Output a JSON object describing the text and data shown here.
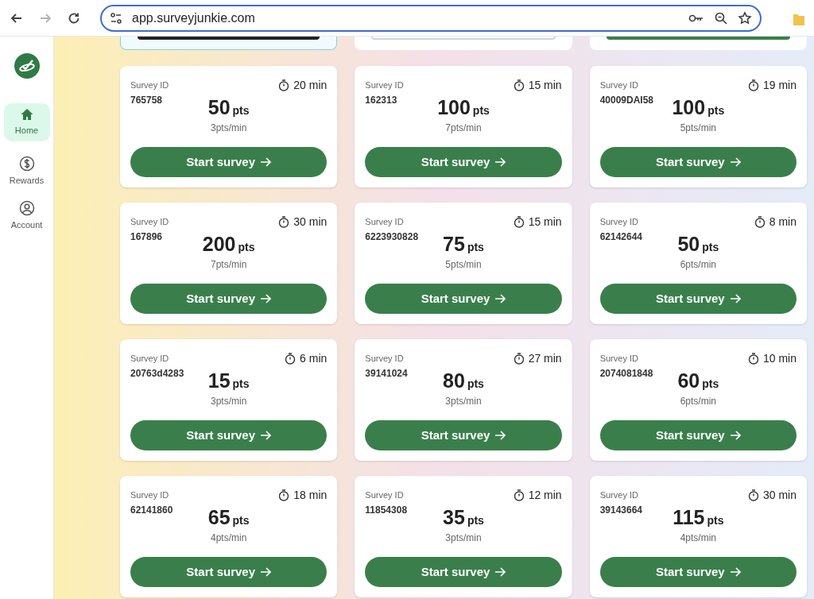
{
  "browser": {
    "url": "app.surveyjunkie.com",
    "forward_disabled": true
  },
  "sidebar": {
    "items": [
      {
        "label": "Home",
        "kind": "home",
        "selected": true
      },
      {
        "label": "Rewards",
        "kind": "rewards",
        "selected": false
      },
      {
        "label": "Account",
        "kind": "account",
        "selected": false
      }
    ]
  },
  "partial_cards": [
    {
      "kind": "featured"
    },
    {
      "kind": "outline"
    },
    {
      "kind": "filled"
    }
  ],
  "surveys": [
    {
      "id_label": "Survey ID",
      "id": "765758",
      "duration": "20 min",
      "points": "50",
      "unit": "pts",
      "rate": "3pts/min",
      "button": "Start survey"
    },
    {
      "id_label": "Survey ID",
      "id": "162313",
      "duration": "15 min",
      "points": "100",
      "unit": "pts",
      "rate": "7pts/min",
      "button": "Start survey"
    },
    {
      "id_label": "Survey ID",
      "id": "40009DAI58",
      "duration": "19 min",
      "points": "100",
      "unit": "pts",
      "rate": "5pts/min",
      "button": "Start survey"
    },
    {
      "id_label": "Survey ID",
      "id": "167896",
      "duration": "30 min",
      "points": "200",
      "unit": "pts",
      "rate": "7pts/min",
      "button": "Start survey"
    },
    {
      "id_label": "Survey ID",
      "id": "6223930828",
      "duration": "15 min",
      "points": "75",
      "unit": "pts",
      "rate": "5pts/min",
      "button": "Start survey"
    },
    {
      "id_label": "Survey ID",
      "id": "62142644",
      "duration": "8 min",
      "points": "50",
      "unit": "pts",
      "rate": "6pts/min",
      "button": "Start survey"
    },
    {
      "id_label": "Survey ID",
      "id": "20763d4283",
      "duration": "6 min",
      "points": "15",
      "unit": "pts",
      "rate": "3pts/min",
      "button": "Start survey"
    },
    {
      "id_label": "Survey ID",
      "id": "39141024",
      "duration": "27 min",
      "points": "80",
      "unit": "pts",
      "rate": "3pts/min",
      "button": "Start survey"
    },
    {
      "id_label": "Survey ID",
      "id": "2074081848",
      "duration": "10 min",
      "points": "60",
      "unit": "pts",
      "rate": "6pts/min",
      "button": "Start survey"
    },
    {
      "id_label": "Survey ID",
      "id": "62141860",
      "duration": "18 min",
      "points": "65",
      "unit": "pts",
      "rate": "4pts/min",
      "button": "Start survey"
    },
    {
      "id_label": "Survey ID",
      "id": "11854308",
      "duration": "12 min",
      "points": "35",
      "unit": "pts",
      "rate": "3pts/min",
      "button": "Start survey"
    },
    {
      "id_label": "Survey ID",
      "id": "39143664",
      "duration": "30 min",
      "points": "115",
      "unit": "pts",
      "rate": "4pts/min",
      "button": "Start survey"
    }
  ]
}
